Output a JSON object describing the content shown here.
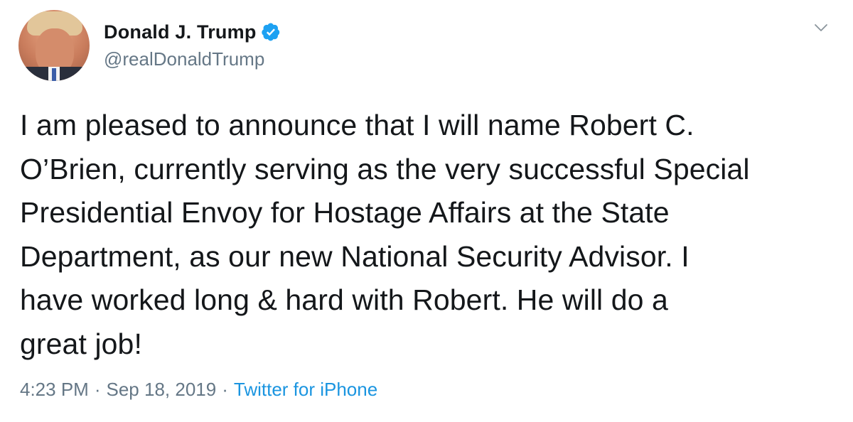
{
  "author": {
    "display_name": "Donald J. Trump",
    "handle": "@realDonaldTrump",
    "verified": true,
    "avatar_icon": "profile-photo"
  },
  "tweet": {
    "text": "I am pleased to announce that I will name Robert C.\nO’Brien, currently serving as the very successful Special\nPresidential Envoy for Hostage Affairs at the State\nDepartment, as our new National Security Advisor. I\nhave worked long & hard with Robert. He will do a\ngreat job!",
    "time": "4:23 PM",
    "separator": "·",
    "date": "Sep 18, 2019",
    "source": "Twitter for iPhone"
  },
  "colors": {
    "text": "#14171a",
    "secondary": "#657786",
    "link": "#1b95e0",
    "verified": "#1da1f2"
  },
  "icons": {
    "menu": "chevron-down-icon",
    "verified": "verified-badge-icon"
  }
}
